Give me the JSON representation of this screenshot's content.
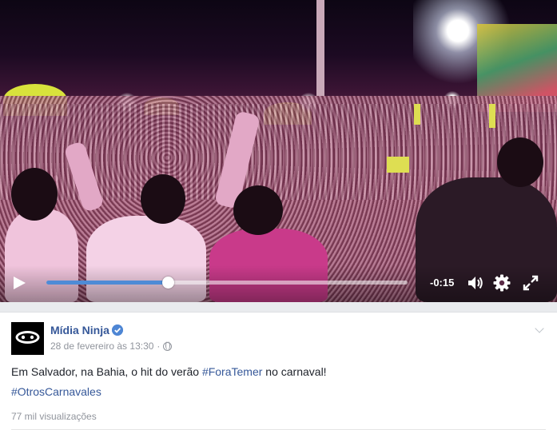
{
  "video": {
    "time_remaining": "-0:15",
    "progress": 0.337
  },
  "post": {
    "author": "Mídia Ninja",
    "date": "28 de fevereiro às 13:30",
    "separator": "·",
    "text_prefix": "Em Salvador, na Bahia, o hit do verão ",
    "hashtag_1": "#ForaTemer",
    "text_suffix": " no carnaval!",
    "hashtag_2": "#OtrosCarnavales",
    "views": "77 mil visualizações"
  },
  "colors": {
    "accent_blue": "#4f8bd6",
    "link_blue": "#365899",
    "muted_text": "#90949c"
  },
  "icons": [
    "play-icon",
    "volume-icon",
    "settings-gear-icon",
    "fullscreen-icon",
    "verified-badge-icon",
    "globe-icon",
    "chevron-down-icon"
  ]
}
